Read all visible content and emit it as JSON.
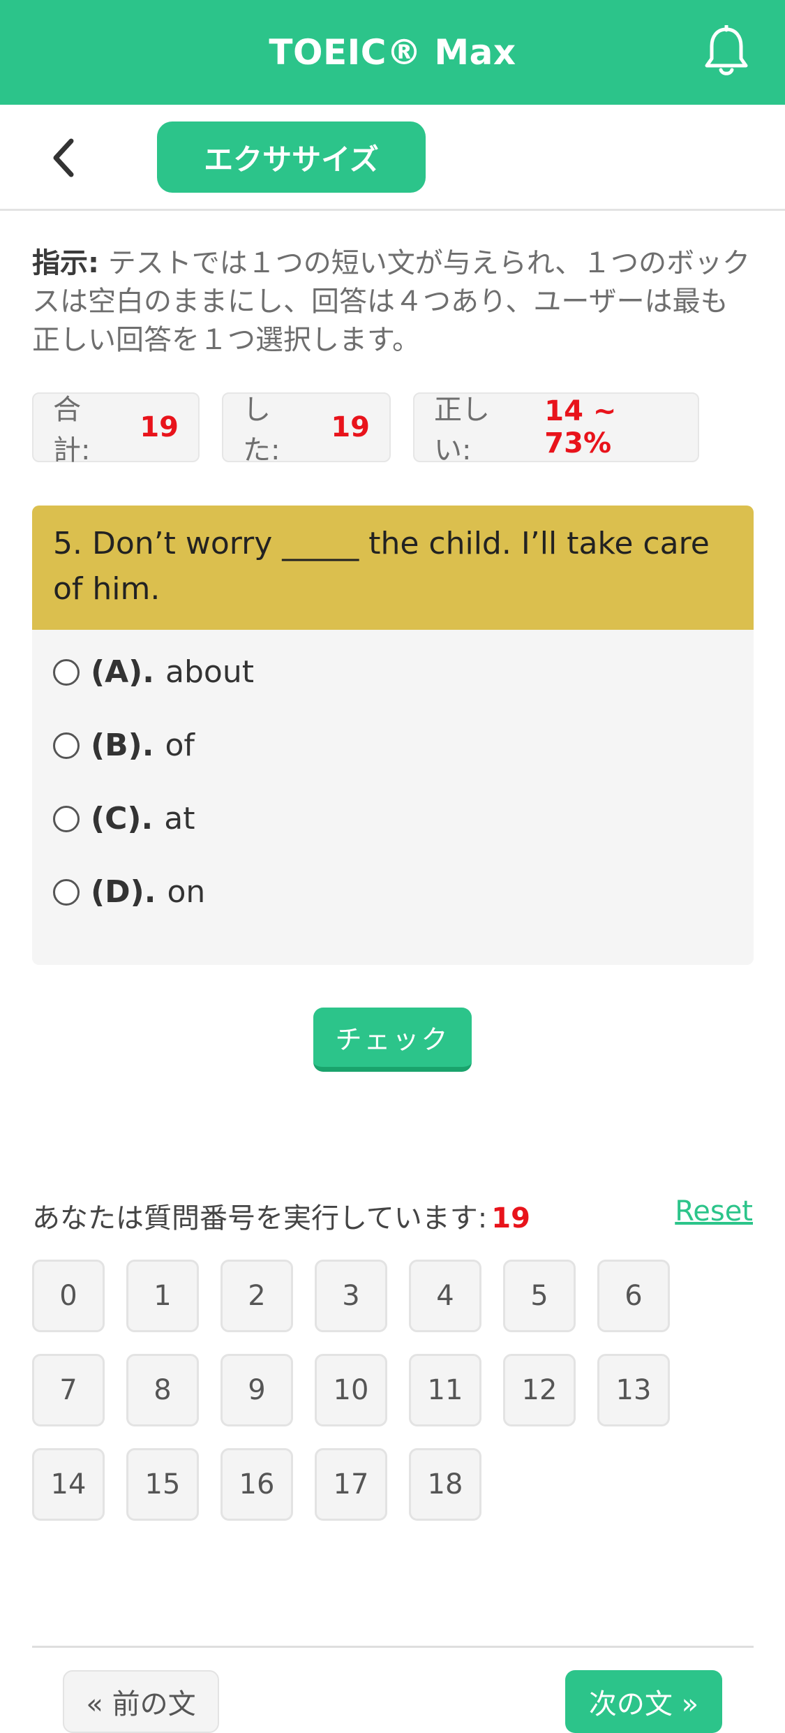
{
  "app": {
    "title": "TOEIC® Max",
    "notification_icon": "bell-icon",
    "accent_color": "#2cc48a"
  },
  "subheader": {
    "back_icon": "chevron-left-icon",
    "tab_label": "エクササイズ"
  },
  "instruction": {
    "prefix": "指示:",
    "text": " テストでは１つの短い文が与えられ、１つのボックスは空白のままにし、回答は４つあり、ユーザーは最も正しい回答を１つ選択します。"
  },
  "stats": {
    "total_label": "合計:",
    "total_value": "19",
    "done_label": "した:",
    "done_value": "19",
    "correct_label": "正しい:",
    "correct_value": "14 ~ 73%"
  },
  "question": {
    "text": "5. Don’t worry _____ the child. I’ll take care of him.",
    "options": [
      {
        "letter": "(A).",
        "text": "about"
      },
      {
        "letter": "(B).",
        "text": "of"
      },
      {
        "letter": "(C).",
        "text": "at"
      },
      {
        "letter": "(D).",
        "text": "on"
      }
    ]
  },
  "check_button": "チェック",
  "progress": {
    "label": "あなたは質問番号を実行しています:",
    "current": "19",
    "reset": "Reset",
    "numbers": [
      "0",
      "1",
      "2",
      "3",
      "4",
      "5",
      "6",
      "7",
      "8",
      "9",
      "10",
      "11",
      "12",
      "13",
      "14",
      "15",
      "16",
      "17",
      "18"
    ]
  },
  "footer": {
    "prev": "« 前の文",
    "next": "次の文 »"
  }
}
